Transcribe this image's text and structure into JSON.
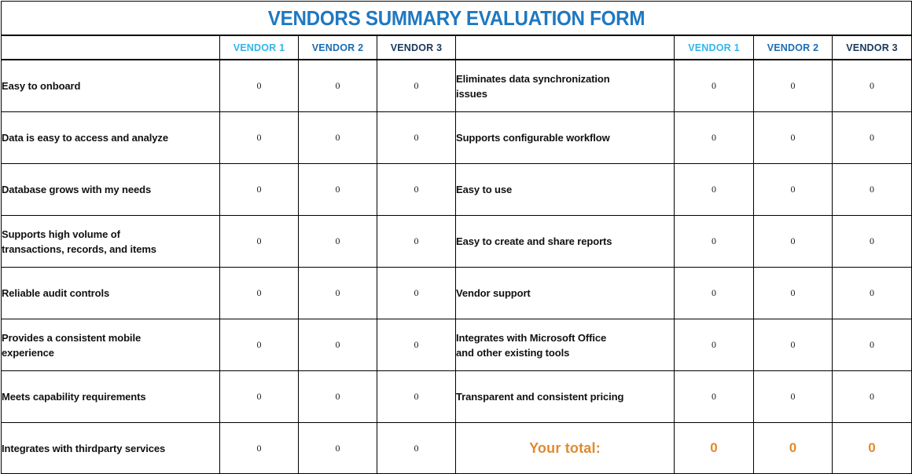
{
  "title": "VENDORS SUMMARY EVALUATION FORM",
  "colors": {
    "title": "#1f78c1",
    "vendor1": "#33b5ea",
    "vendor2": "#1c6eb4",
    "vendor3": "#1b3a5c",
    "total": "#e08a2e",
    "text": "#111111",
    "border": "#000000"
  },
  "headers": {
    "left_blank": "",
    "right_blank": "",
    "left": [
      {
        "label": "VENDOR 1",
        "color_key": "vendor1"
      },
      {
        "label": "VENDOR 2",
        "color_key": "vendor2"
      },
      {
        "label": "VENDOR 3",
        "color_key": "vendor3"
      }
    ],
    "right": [
      {
        "label": "VENDOR 1",
        "color_key": "vendor1"
      },
      {
        "label": "VENDOR 2",
        "color_key": "vendor2"
      },
      {
        "label": "VENDOR 3",
        "color_key": "vendor3"
      }
    ]
  },
  "rows": [
    {
      "left": {
        "line1": "Easy to onboard",
        "line2": "",
        "scores": [
          "0",
          "0",
          "0"
        ]
      },
      "right": {
        "line1": "Eliminates data synchronization",
        "line2": "issues",
        "scores": [
          "0",
          "0",
          "0"
        ]
      }
    },
    {
      "left": {
        "line1": "Data is easy to access and analyze",
        "line2": "",
        "scores": [
          "0",
          "0",
          "0"
        ]
      },
      "right": {
        "line1": "Supports configurable workflow",
        "line2": "",
        "scores": [
          "0",
          "0",
          "0"
        ]
      }
    },
    {
      "left": {
        "line1": "Database grows with my needs",
        "line2": "",
        "scores": [
          "0",
          "0",
          "0"
        ]
      },
      "right": {
        "line1": "Easy to use",
        "line2": "",
        "scores": [
          "0",
          "0",
          "0"
        ]
      }
    },
    {
      "left": {
        "line1": "Supports high volume of",
        "line2": "transactions, records, and items",
        "scores": [
          "0",
          "0",
          "0"
        ]
      },
      "right": {
        "line1": "Easy to create and share reports",
        "line2": "",
        "scores": [
          "0",
          "0",
          "0"
        ]
      }
    },
    {
      "left": {
        "line1": "Reliable audit controls",
        "line2": "",
        "scores": [
          "0",
          "0",
          "0"
        ]
      },
      "right": {
        "line1": "Vendor support",
        "line2": "",
        "scores": [
          "0",
          "0",
          "0"
        ]
      }
    },
    {
      "left": {
        "line1": "Provides a consistent mobile",
        "line2": "experience",
        "scores": [
          "0",
          "0",
          "0"
        ]
      },
      "right": {
        "line1": "Integrates with Microsoft Office",
        "line2": "and other existing tools",
        "scores": [
          "0",
          "0",
          "0"
        ]
      }
    },
    {
      "left": {
        "line1": "Meets capability requirements",
        "line2": "",
        "scores": [
          "0",
          "0",
          "0"
        ]
      },
      "right": {
        "line1": "Transparent and consistent pricing",
        "line2": "",
        "scores": [
          "0",
          "0",
          "0"
        ]
      }
    }
  ],
  "total_row": {
    "left": {
      "line1": "Integrates with thirdparty services",
      "line2": "",
      "scores": [
        "0",
        "0",
        "0"
      ]
    },
    "label": "Your total:",
    "totals": [
      "0",
      "0",
      "0"
    ]
  }
}
